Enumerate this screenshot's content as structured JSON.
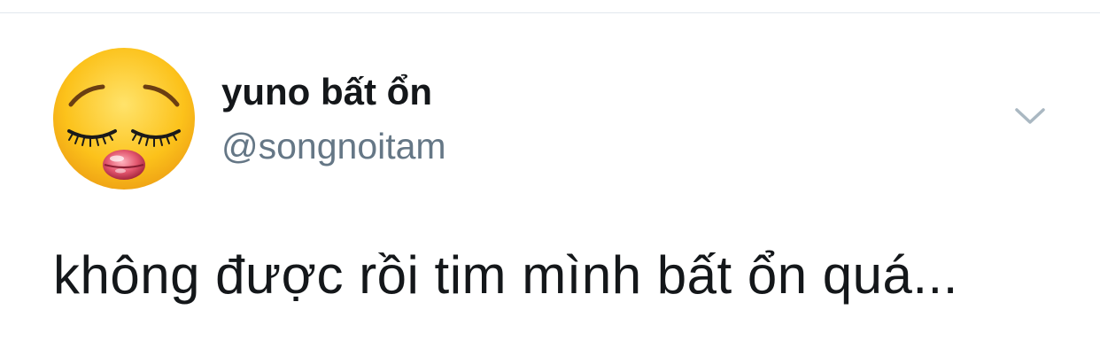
{
  "tweet": {
    "author": {
      "display_name": "yuno bất ổn",
      "handle": "@songnoitam",
      "avatar_icon": "pensive-face-emoji-with-lips-avatar"
    },
    "menu_icon": "chevron-down-icon",
    "text": "không được rồi tim mình bất ổn quá..."
  },
  "colors": {
    "name": "#14171a",
    "handle": "#657786",
    "divider": "#e1e8ed",
    "chevron": "#aab8c2"
  }
}
